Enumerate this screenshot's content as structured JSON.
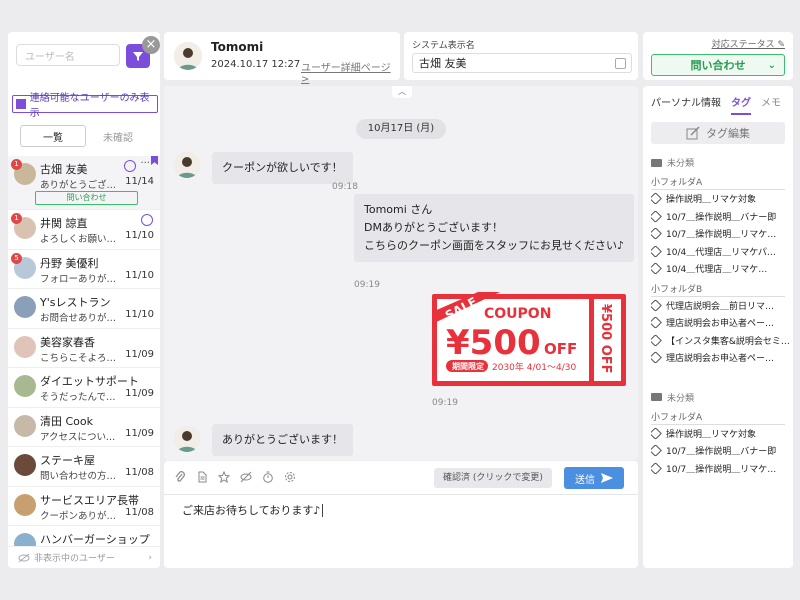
{
  "left": {
    "search_placeholder": "ユーザー名",
    "contact_filter_label": "連絡可能なユーザーのみ表示",
    "tabs": [
      "一覧",
      "未確認"
    ],
    "users": [
      {
        "name": "古畑 友美",
        "preview": "ありがとうござい…",
        "date": "11/14",
        "badge": "1",
        "timer": true,
        "selected": true,
        "tag": "問い合わせ"
      },
      {
        "name": "井関 諒直",
        "preview": "よろしくお願いし…",
        "date": "11/10",
        "badge": "1",
        "timer": true
      },
      {
        "name": "丹野 美優利",
        "preview": "フォローありがと…",
        "date": "11/10",
        "badge": "5"
      },
      {
        "name": "Y'sレストラン",
        "preview": "お問合せありがと…",
        "date": "11/10"
      },
      {
        "name": "美容家春香",
        "preview": "こちらこそよろし…",
        "date": "11/09"
      },
      {
        "name": "ダイエットサポート",
        "preview": "そうだったんです…",
        "date": "11/09"
      },
      {
        "name": "清田 Cook",
        "preview": "アクセスについて…",
        "date": "11/09"
      },
      {
        "name": "ステーキ屋",
        "preview": "問い合わせの方法…",
        "date": "11/08"
      },
      {
        "name": "サービスエリア長帯",
        "preview": "クーポンありがと…",
        "date": "11/08"
      },
      {
        "name": "ハンバーガーショップ",
        "preview": "",
        "date": ""
      }
    ],
    "hidden_users_label": "非表示中のユーザー"
  },
  "header": {
    "name": "Tomomi",
    "timestamp": "2024.10.17 12:27",
    "detail_link": "ユーザー詳細ページ >"
  },
  "system_name": {
    "label": "システム表示名",
    "value": "古畑 友美"
  },
  "status": {
    "label": "対応ステータス",
    "value": "問い合わせ",
    "color": "#3bbf6a"
  },
  "chat": {
    "date": "10月17日 (月)",
    "messages": [
      {
        "from": "user",
        "text": [
          "クーポンが欲しいです！"
        ],
        "time": "09:18"
      },
      {
        "from": "staff",
        "text": [
          "Tomomi さん",
          "DMありがとうございます！",
          "こちらのクーポン画面をスタッフにお見せください♪"
        ],
        "time": "09:19"
      },
      {
        "from": "staff",
        "type": "image",
        "time": "09:19"
      },
      {
        "from": "user",
        "text": [
          "ありがとうございます！"
        ],
        "time": ""
      }
    ],
    "coupon": {
      "sale": "SALE",
      "title": "COUPON",
      "amount": "¥500",
      "off": "OFF",
      "limited": "期間限定",
      "period": "2030年 4/01～4/30",
      "side": "¥500 OFF"
    }
  },
  "composer": {
    "confirm_label": "確認済 (クリックで変更)",
    "send_label": "送信",
    "text": "ご来店お待ちしております♪"
  },
  "right": {
    "tabs": [
      "パーソナル情報",
      "タグ",
      "メモ"
    ],
    "tag_edit_label": "タグ編集",
    "sections": [
      {
        "title": "未分類",
        "folders": [
          {
            "name": "小フォルダA",
            "tags": [
              "操作説明＿リマケ対象",
              "10/7＿操作説明＿バナー即",
              "10/7＿操作説明＿リマケ…",
              "10/4＿代理店＿リマケパ…",
              "10/4＿代理店＿リマケ…"
            ]
          },
          {
            "name": "小フォルダB",
            "tags": [
              "代理店説明会＿前日リマ…",
              "理店説明会お申込者ペー…",
              "【インスタ集客&説明会セミ…",
              "理店説明会お申込者ペー…"
            ]
          }
        ]
      },
      {
        "title": "未分類",
        "folders": [
          {
            "name": "小フォルダA",
            "tags": [
              "操作説明＿リマケ対象",
              "10/7＿操作説明＿バナー即",
              "10/7＿操作説明＿リマケ…"
            ]
          }
        ]
      }
    ]
  },
  "colors": {
    "accent": "#7c4ddb",
    "send": "#4a8fe0",
    "coupon": "#e8313a"
  }
}
